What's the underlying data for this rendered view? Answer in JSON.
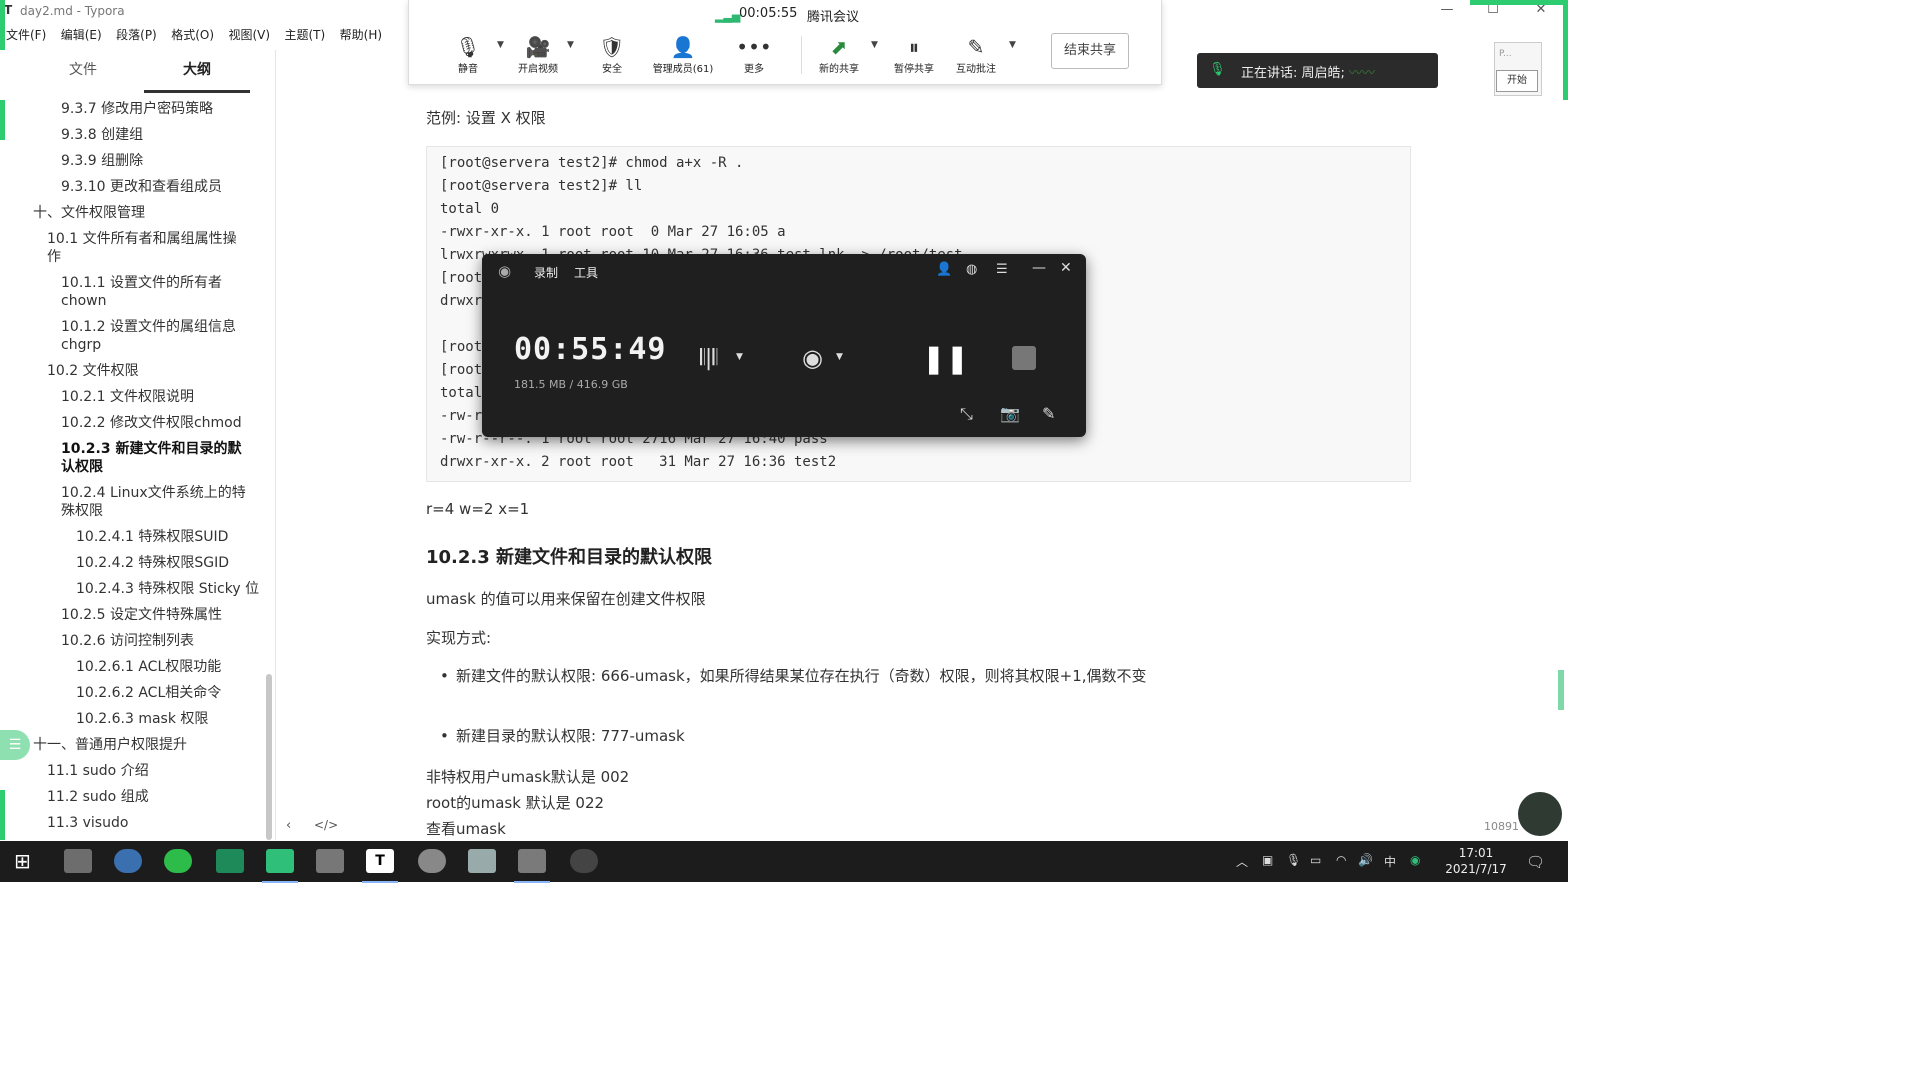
{
  "app": {
    "title": "day2.md - Typora",
    "menu": [
      "文件(F)",
      "编辑(E)",
      "段落(P)",
      "格式(O)",
      "视图(V)",
      "主题(T)",
      "帮助(H)"
    ]
  },
  "sidebar": {
    "tabs": [
      "文件",
      "大纲"
    ],
    "active_tab": "大纲",
    "items": [
      {
        "label": "9.3.7 修改用户密码策略"
      },
      {
        "label": "9.3.8 创建组"
      },
      {
        "label": "9.3.9 组删除"
      },
      {
        "label": "9.3.10 更改和查看组成员"
      },
      {
        "label": "十、文件权限管理"
      },
      {
        "label": "10.1 文件所有者和属组属性操作"
      },
      {
        "label": "10.1.1 设置文件的所有者chown"
      },
      {
        "label": "10.1.2 设置文件的属组信息chgrp"
      },
      {
        "label": "10.2 文件权限"
      },
      {
        "label": "10.2.1 文件权限说明"
      },
      {
        "label": "10.2.2 修改文件权限chmod"
      },
      {
        "label": "10.2.3 新建文件和目录的默认权限"
      },
      {
        "label": "10.2.4 Linux文件系统上的特殊权限"
      },
      {
        "label": "10.2.4.1 特殊权限SUID"
      },
      {
        "label": "10.2.4.2 特殊权限SGID"
      },
      {
        "label": "10.2.4.3 特殊权限 Sticky 位"
      },
      {
        "label": "10.2.5 设定文件特殊属性"
      },
      {
        "label": "10.2.6 访问控制列表"
      },
      {
        "label": "10.2.6.1 ACL权限功能"
      },
      {
        "label": "10.2.6.2 ACL相关命令"
      },
      {
        "label": "10.2.6.3 mask 权限"
      },
      {
        "label": "十一、普通用户权限提升"
      },
      {
        "label": "11.1 sudo 介绍"
      },
      {
        "label": "11.2 sudo 组成"
      },
      {
        "label": "11.3 visudo"
      }
    ]
  },
  "meeting": {
    "timer": "00:05:55",
    "name": "腾讯会议",
    "buttons": [
      {
        "label": "静音",
        "icon": "microphone-icon"
      },
      {
        "label": "开启视频",
        "icon": "camera-off-icon"
      },
      {
        "label": "安全",
        "icon": "shield-icon"
      },
      {
        "label": "管理成员(61)",
        "icon": "members-icon"
      },
      {
        "label": "更多",
        "icon": "more-icon"
      },
      {
        "label": "新的共享",
        "icon": "share-icon"
      },
      {
        "label": "暂停共享",
        "icon": "pause-share-icon"
      },
      {
        "label": "互动批注",
        "icon": "annotate-icon"
      }
    ],
    "end_share": "结束共享",
    "speaking": "正在讲话: 周启皓;"
  },
  "mini_panel": {
    "title": "P...",
    "button": "开始"
  },
  "document": {
    "example_title": "范例: 设置 X 权限",
    "code_lines": [
      "[root@servera test2]# chmod a+x -R .",
      "[root@servera test2]# ll",
      "total 0",
      "-rwxr-xr-x. 1 root root  0 Mar 27 16:05 a",
      "lrwxrwxrwx. 1 root root 10 Mar 27 16:36 test.lnk -> /root/test",
      "[root",
      "drwxr",
      "",
      "[root",
      "[root",
      "total",
      "-rw-r",
      "-rw-r--r--. 1 root root 2716 Mar 27 16:40 pass",
      "drwxr-xr-x. 2 root root   31 Mar 27 16:36 test2"
    ],
    "perm_values": "r=4 w=2 x=1",
    "heading": "10.2.3 新建文件和目录的默认权限",
    "umask_desc": "umask 的值可以用来保留在创建文件权限",
    "impl_label": "实现方式:",
    "bullets": [
      "新建文件的默认权限: 666-umask，如果所得结果某位存在执行（奇数）权限，则将其权限+1,偶数不变",
      "新建目录的默认权限: 777-umask"
    ],
    "line_nonpriv": "非特权用户umask默认是 002",
    "line_root": "root的umask 默认是 022",
    "line_view": "查看umask"
  },
  "recorder": {
    "menu": [
      "录制",
      "工具"
    ],
    "time": "00:55:49",
    "storage": "181.5 MB / 416.9 GB"
  },
  "status": {
    "word_count": "10891"
  },
  "taskbar": {
    "time": "17:01",
    "date": "2021/7/17",
    "ime": "中"
  }
}
